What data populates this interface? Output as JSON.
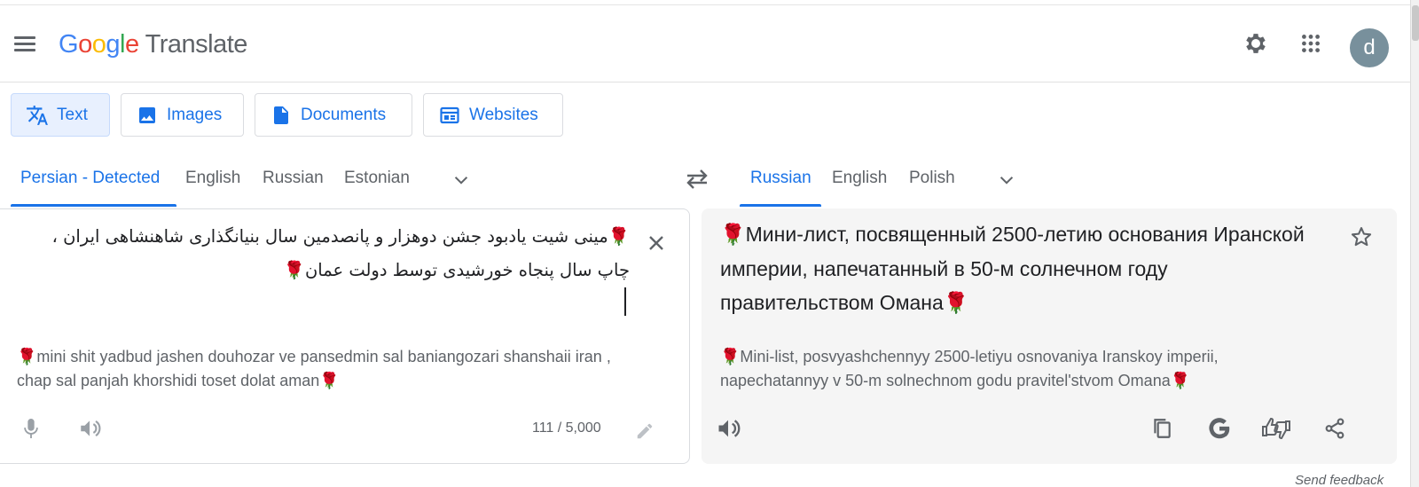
{
  "app": {
    "logo_letters": [
      "G",
      "o",
      "o",
      "g",
      "l",
      "e"
    ],
    "product": "Translate",
    "avatar_initial": "d",
    "icons": [
      "menu-icon",
      "settings-icon",
      "apps-icon"
    ]
  },
  "modes": [
    {
      "label": "Text",
      "icon": "translate-icon",
      "active": true
    },
    {
      "label": "Images",
      "icon": "image-icon",
      "active": false
    },
    {
      "label": "Documents",
      "icon": "document-icon",
      "active": false
    },
    {
      "label": "Websites",
      "icon": "website-icon",
      "active": false
    }
  ],
  "source": {
    "languages": [
      "Persian - Detected",
      "English",
      "Russian",
      "Estonian"
    ],
    "active_language": "Persian - Detected",
    "text": "مینی شیت یادبود جشن دوهزار و پانصدمین سال بنیانگذاری شاهنشاهی ایران ، چاپ سال پنجاه خورشیدی توسط دولت عمان",
    "transliteration": "mini shit yadbud jashen douhozar ve pansedmin sal baniangozari shanshaii iran , chap sal panjah khorshidi toset dolat aman",
    "char_count": "111 / 5,000",
    "decoration": "🌹"
  },
  "target": {
    "languages": [
      "Russian",
      "English",
      "Polish"
    ],
    "active_language": "Russian",
    "text": "Мини-лист, посвященный 2500-летию основания Иранской империи, напечатанный в 50-м солнечном году правительством Омана",
    "transliteration": "Mini-list, posvyashchennyy 2500-letiyu osnovaniya Iranskoy imperii, napechatannyy v 50-m solnechnom godu pravitel'stvom Omana"
  },
  "footer": {
    "send_feedback": "Send feedback"
  },
  "colors": {
    "accent": "#1a73e8",
    "active_tab_bg": "#e8f0fe",
    "target_panel_bg": "#f5f5f5",
    "avatar_bg": "#78909c"
  }
}
